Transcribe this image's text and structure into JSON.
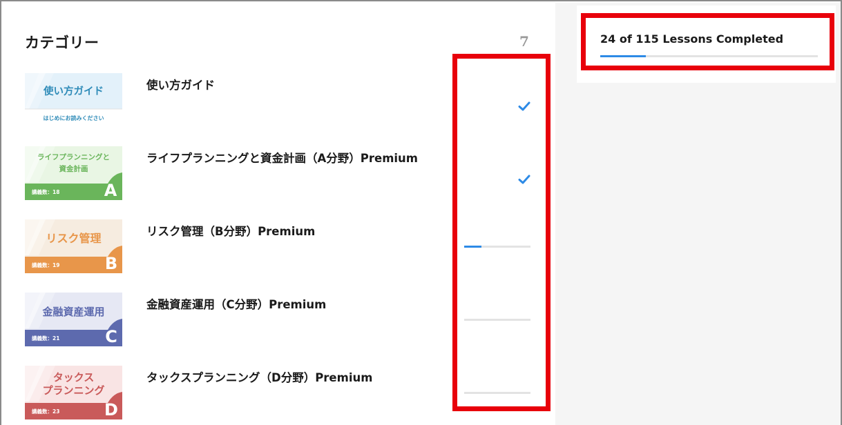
{
  "categories": {
    "title": "カテゴリー",
    "count": "7",
    "items": [
      {
        "title": "使い方ガイド",
        "thumb": {
          "main": "使い方ガイド",
          "sub": "はじめにお読みください",
          "bg": "#e3f1fa",
          "accent": "#2e8bb8"
        },
        "status": "complete"
      },
      {
        "title": "ライフプランニングと資金計画（A分野）Premium",
        "thumb": {
          "line1": "ライフプランニングと",
          "line2": "資金計画",
          "lessons": "講義数：18",
          "letter": "A",
          "bg": "#e9f6e4",
          "accent": "#6ab55b"
        },
        "status": "complete"
      },
      {
        "title": "リスク管理（B分野）Premium",
        "thumb": {
          "line1": "リスク管理",
          "lessons": "講義数：19",
          "letter": "B",
          "bg": "#f6ece0",
          "accent": "#e8964a"
        },
        "status": "progress",
        "progress": 0.26
      },
      {
        "title": "金融資産運用（C分野）Premium",
        "thumb": {
          "line1": "金融資産運用",
          "lessons": "講義数：21",
          "letter": "C",
          "bg": "#e6e8f4",
          "accent": "#5d6aae"
        },
        "status": "progress",
        "progress": 0
      },
      {
        "title": "タックスプランニング（D分野）Premium",
        "thumb": {
          "line1": "タックス",
          "line2": "プランニング",
          "lessons": "講義数：23",
          "letter": "D",
          "bg": "#f9e4e4",
          "accent": "#c95a5a"
        },
        "status": "progress",
        "progress": 0
      }
    ]
  },
  "summary": {
    "text": "24 of 115 Lessons Completed",
    "progress": 0.21
  },
  "colors": {
    "highlight": "#e8000b",
    "progress_fill": "#2d8ae6",
    "progress_track": "#e3e3e3",
    "check": "#2d8ae6"
  }
}
